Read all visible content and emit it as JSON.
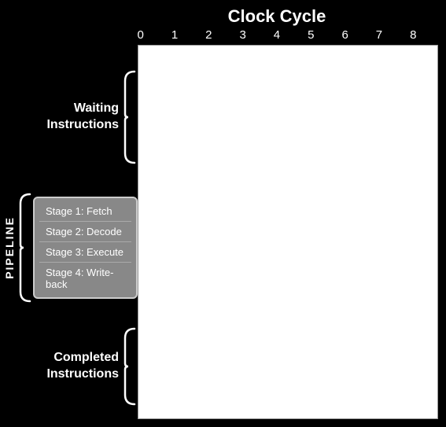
{
  "header": {
    "title": "Clock Cycle",
    "cycle_numbers": [
      "0",
      "1",
      "2",
      "3",
      "4",
      "5",
      "6",
      "7",
      "8"
    ]
  },
  "labels": {
    "waiting": "Waiting\nInstructions",
    "pipeline": "PIPELINE",
    "completed": "Completed\nInstructions"
  },
  "stages": [
    "Stage 1: Fetch",
    "Stage 2: Decode",
    "Stage 3: Execute",
    "Stage 4: Write-back"
  ]
}
